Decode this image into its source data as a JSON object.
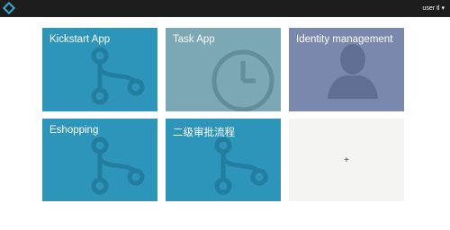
{
  "header": {
    "logo_icon": "diamond-logo-icon",
    "user_label": "user tl",
    "user_menu_icon": "chevron-down-icon"
  },
  "apps": [
    {
      "name": "Kickstart App",
      "icon": "workflow-icon",
      "color": "#2e95ba"
    },
    {
      "name": "Task App",
      "icon": "clock-icon",
      "color": "#7ca7b4"
    },
    {
      "name": "Identity management",
      "icon": "user-silhouette-icon",
      "color": "#7b88ad"
    },
    {
      "name": "Eshopping",
      "icon": "workflow-icon",
      "color": "#2e95ba"
    },
    {
      "name": "二级审批流程",
      "icon": "workflow-icon",
      "color": "#2e95ba"
    }
  ],
  "add_tile": {
    "label": "+"
  },
  "colors": {
    "topbar": "#1d1d1d",
    "logo_accent": "#3aa7d9"
  }
}
